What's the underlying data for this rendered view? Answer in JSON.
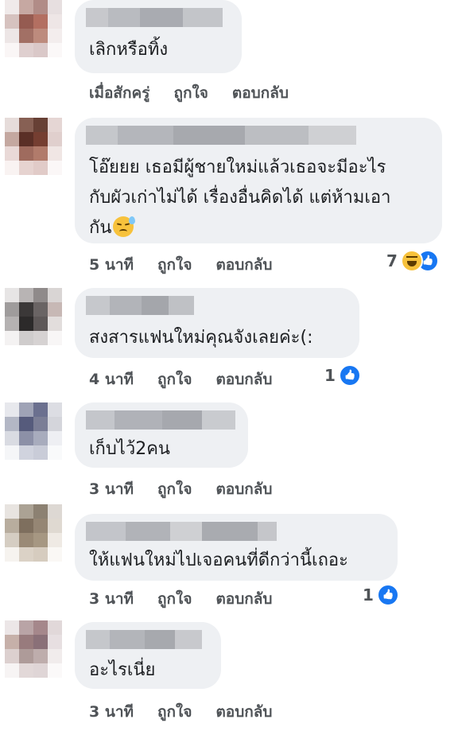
{
  "comments": [
    {
      "text": [
        "เลิกหรือทิ้ง"
      ],
      "time": "เมื่อสักครู่",
      "like": "ถูกใจ",
      "reply": "ตอบกลับ",
      "reactions": null
    },
    {
      "text": [
        "โอ๊ยยย เธอมีผู้ชายใหม่แล้วเธอจะมีอะไร",
        "กับผัวเก่าไม่ได้ เรื่องอื่นคิดได้ แต่ห้ามเอา",
        "กัน"
      ],
      "time": "5 นาที",
      "like": "ถูกใจ",
      "reply": "ตอบกลับ",
      "reactions": {
        "count": "7",
        "icons": [
          "haha-icon",
          "like-icon"
        ]
      }
    },
    {
      "text": [
        "สงสารแฟนใหม่คุณจังเลยค่ะ(:"
      ],
      "time": "4 นาที",
      "like": "ถูกใจ",
      "reply": "ตอบกลับ",
      "reactions": {
        "count": "1",
        "icons": [
          "like-icon"
        ]
      }
    },
    {
      "text": [
        "เก็บไว้2คน"
      ],
      "time": "3 นาที",
      "like": "ถูกใจ",
      "reply": "ตอบกลับ",
      "reactions": null
    },
    {
      "text": [
        "ให้แฟนใหม่ไปเจอคนที่ดีกว่านี้เถอะ"
      ],
      "time": "3 นาที",
      "like": "ถูกใจ",
      "reply": "ตอบกลับ",
      "reactions": {
        "count": "1",
        "icons": [
          "like-icon"
        ]
      }
    },
    {
      "text": [
        "อะไรเนี่ย"
      ],
      "time": "3 นาที",
      "like": "ถูกใจ",
      "reply": "ตอบกลับ",
      "reactions": null
    }
  ],
  "colors": {
    "bubble": "#eef0f3",
    "like": "#1877f2",
    "meta": "#4f5357"
  }
}
